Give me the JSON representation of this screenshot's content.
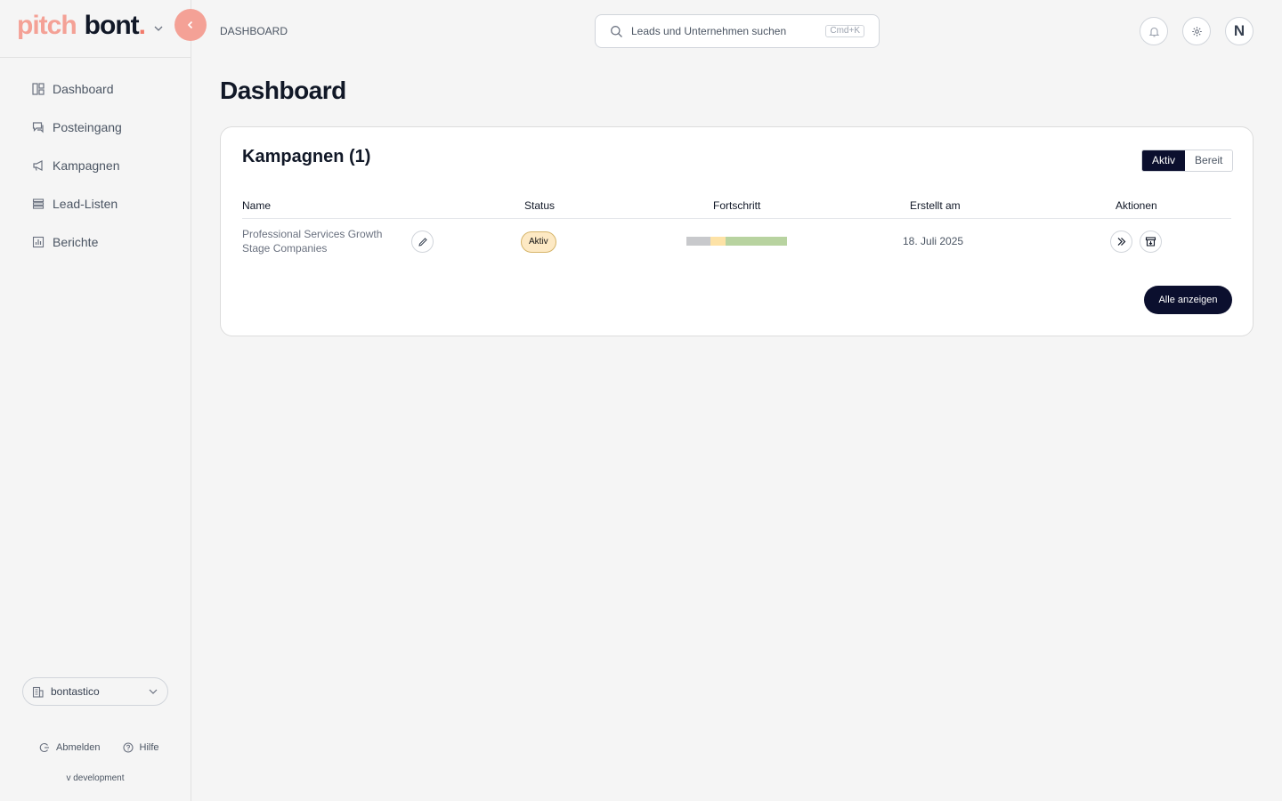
{
  "brand": {
    "part1": "pitch",
    "part2": "bont",
    "dot": "."
  },
  "sidebar": {
    "items": [
      {
        "label": "Dashboard",
        "icon": "dashboard-icon"
      },
      {
        "label": "Posteingang",
        "icon": "chat-icon"
      },
      {
        "label": "Kampagnen",
        "icon": "megaphone-icon"
      },
      {
        "label": "Lead-Listen",
        "icon": "list-icon"
      },
      {
        "label": "Berichte",
        "icon": "bar-chart-icon"
      }
    ],
    "org": "bontastico",
    "logout": "Abmelden",
    "help": "Hilfe",
    "version": "v development"
  },
  "header": {
    "breadcrumb": "DASHBOARD",
    "search_placeholder": "Leads und Unternehmen suchen",
    "search_shortcut": "Cmd+K",
    "avatar_initial": "N"
  },
  "main": {
    "title": "Dashboard",
    "campaigns": {
      "title": "Kampagnen (1)",
      "filters": [
        "Aktiv",
        "Bereit"
      ],
      "active_filter": "Aktiv",
      "columns": [
        "Name",
        "Status",
        "Fortschritt",
        "Erstellt am",
        "Aktionen"
      ],
      "rows": [
        {
          "name": "Professional Services Growth Stage Companies",
          "status": "Aktiv",
          "progress_segments": [
            {
              "fraction": 0.24,
              "color": "#c8c9cc"
            },
            {
              "fraction": 0.15,
              "color": "#fde2a6"
            },
            {
              "fraction": 0.61,
              "color": "#b8d3a0"
            }
          ],
          "created": "18. Juli 2025"
        }
      ],
      "show_all": "Alle anzeigen"
    }
  },
  "colors": {
    "accent": "#f4a196",
    "dark": "#0b0f2e",
    "badge_bg": "#fde9c4"
  }
}
